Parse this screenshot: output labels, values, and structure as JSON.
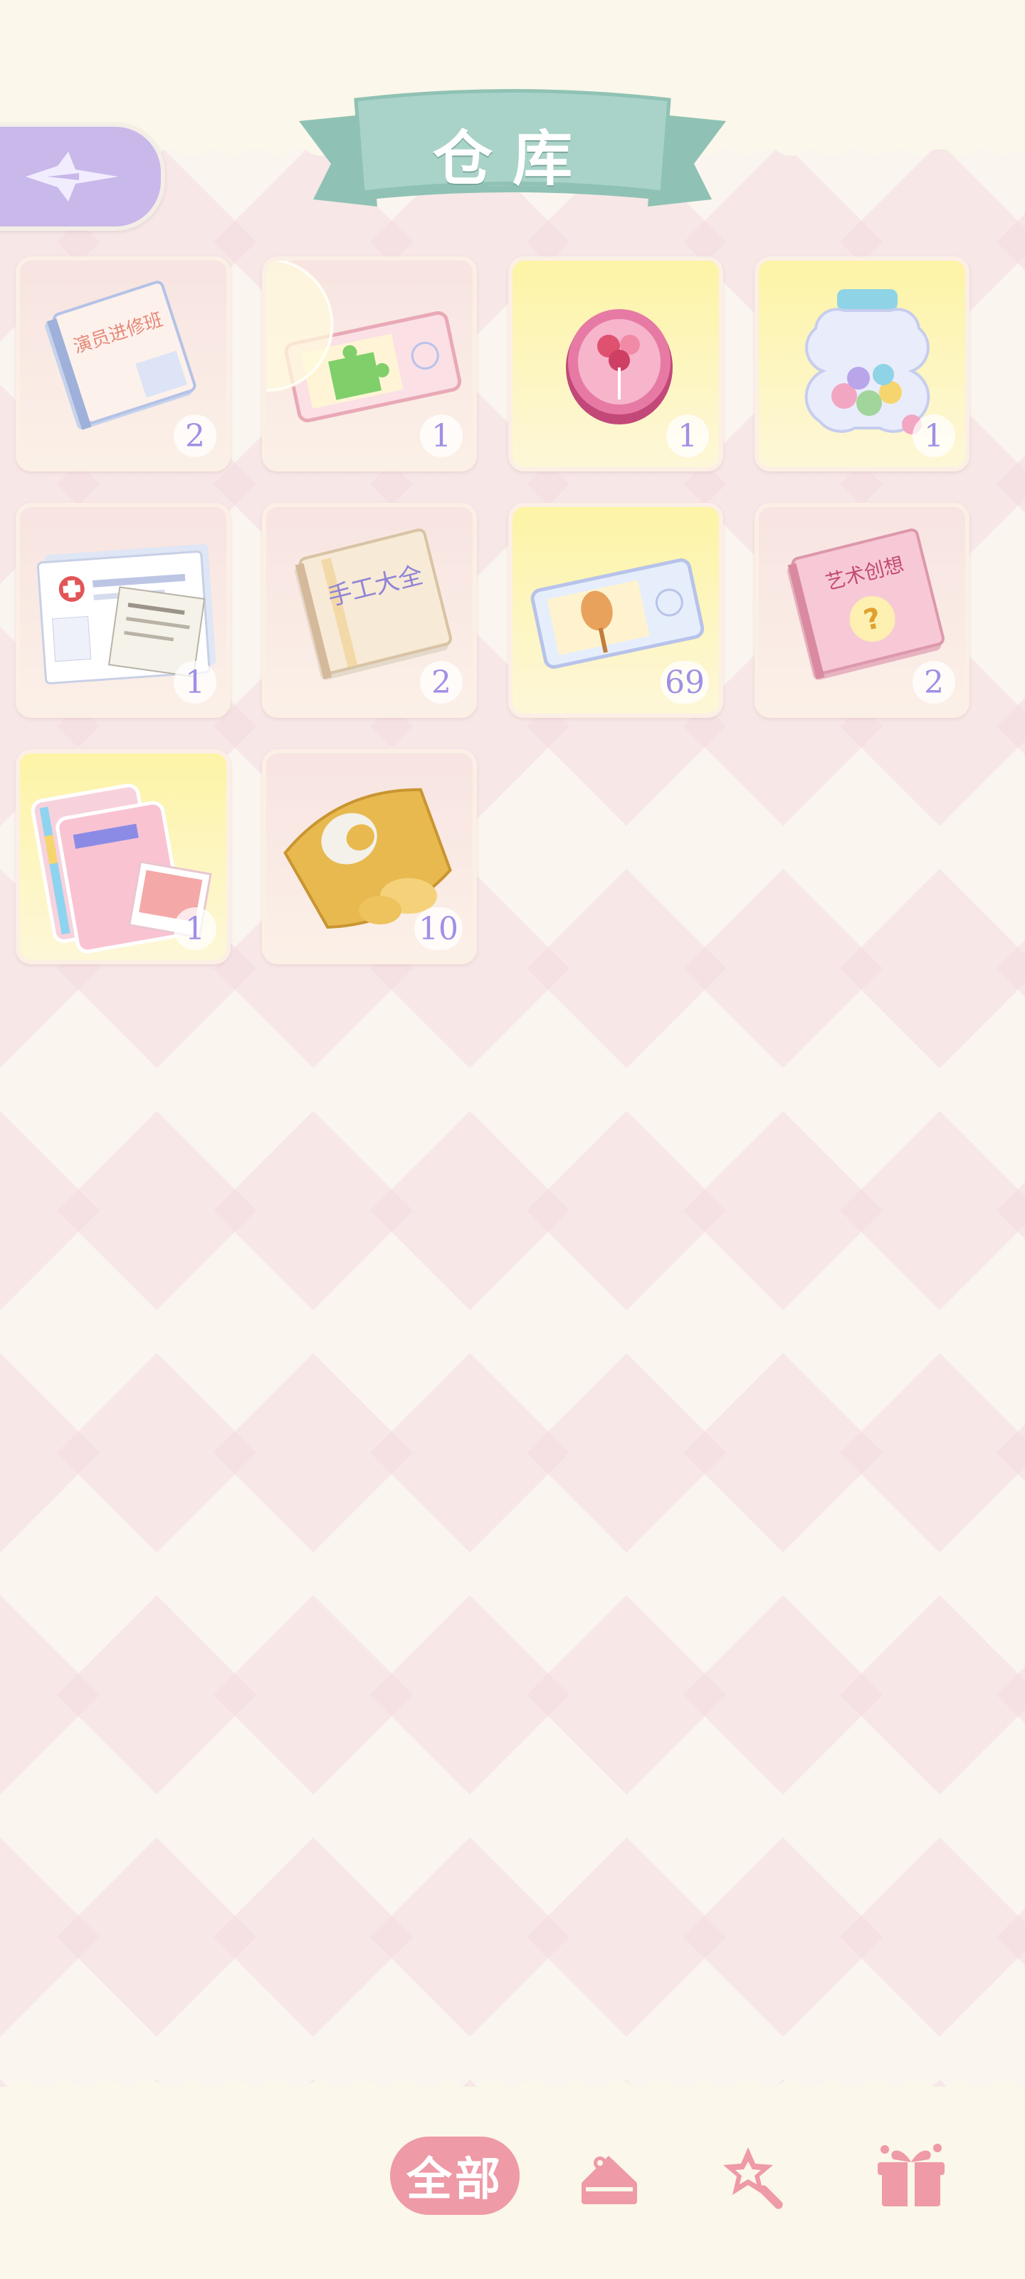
{
  "header": {
    "title": "仓库"
  },
  "items": [
    {
      "name": "演员进修班",
      "qty": "2",
      "bg": "pink",
      "icon": "book-icon"
    },
    {
      "name": "",
      "qty": "1",
      "bg": "pink",
      "icon": "puzzle-ticket-icon"
    },
    {
      "name": "",
      "qty": "1",
      "bg": "yellow",
      "icon": "candy-tin-icon"
    },
    {
      "name": "",
      "qty": "1",
      "bg": "yellow",
      "icon": "candy-jar-icon"
    },
    {
      "name": "",
      "qty": "1",
      "bg": "pink",
      "icon": "medical-papers-icon"
    },
    {
      "name": "手工大全",
      "qty": "2",
      "bg": "pink",
      "icon": "craft-book-icon"
    },
    {
      "name": "",
      "qty": "69",
      "bg": "yellow",
      "icon": "snack-ticket-icon"
    },
    {
      "name": "艺术创想",
      "qty": "2",
      "bg": "pink",
      "icon": "art-book-icon"
    },
    {
      "name": "",
      "qty": "1",
      "bg": "yellow",
      "icon": "photo-cards-icon"
    },
    {
      "name": "",
      "qty": "10",
      "bg": "pink",
      "icon": "chips-bag-icon"
    }
  ],
  "tabs": {
    "all_label": "全部",
    "food_icon": "cake-icon",
    "toy_icon": "magic-wand-icon",
    "gift_icon": "gift-box-icon"
  },
  "colors": {
    "accent": "#ee9aa7",
    "qty_text": "#a08fe6",
    "banner": "#a9d3c8",
    "back_button": "#c9b8ea"
  }
}
